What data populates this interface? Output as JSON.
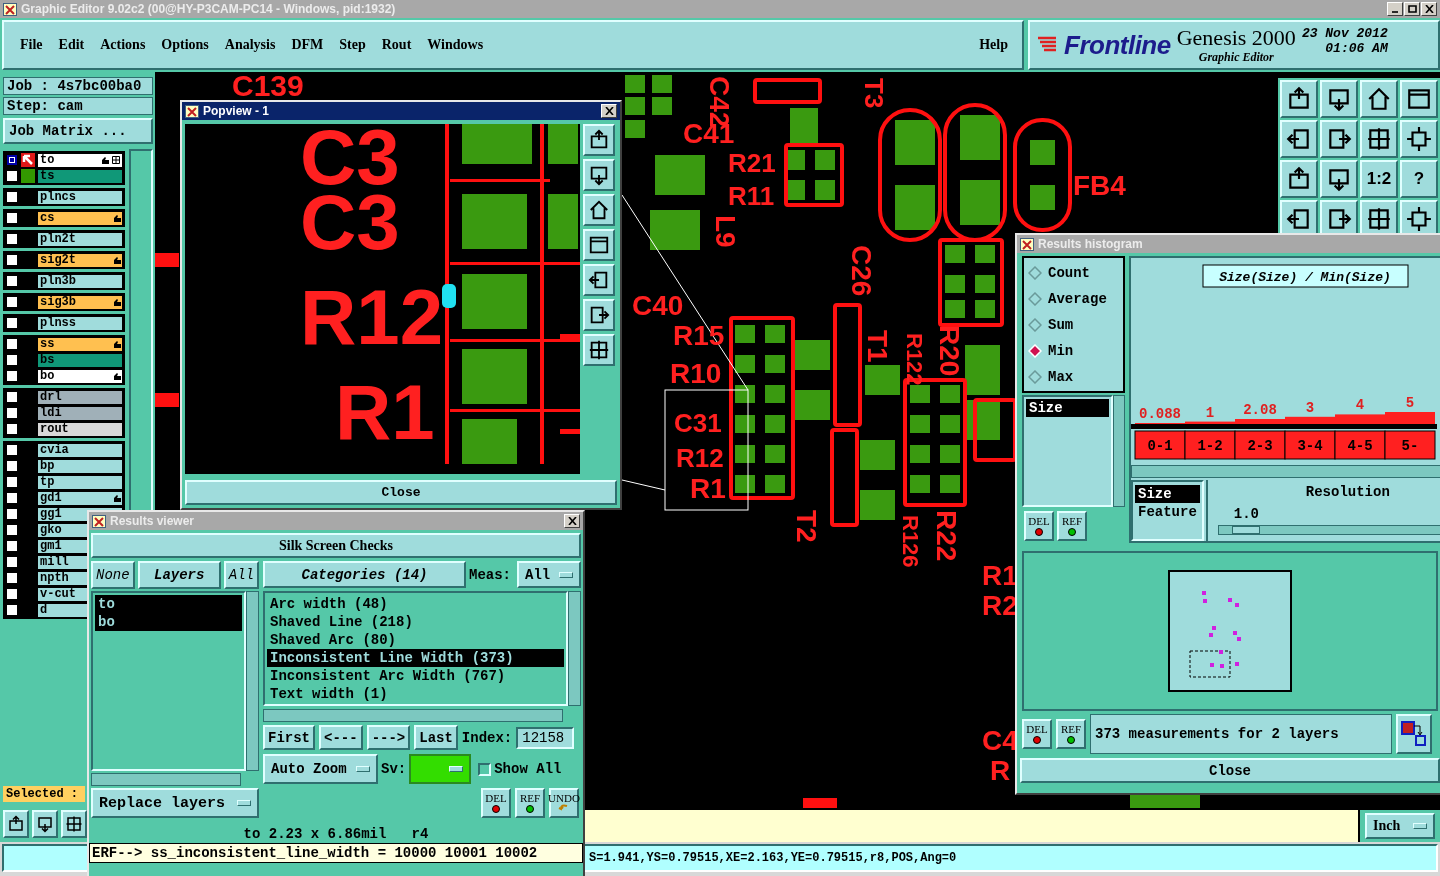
{
  "window": {
    "title": "Graphic Editor 9.02c2 (00@HY-P3CAM-PC14 - Windows, pid:1932)"
  },
  "menu": {
    "items": [
      "File",
      "Edit",
      "Actions",
      "Options",
      "Analysis",
      "DFM",
      "Step",
      "Rout",
      "Windows"
    ],
    "help": "Help"
  },
  "brand": {
    "logo": "Frontline",
    "product": "Genesis 2000",
    "subtitle": "Graphic Editor",
    "date": "23 Nov 2012",
    "time": "01:06 AM"
  },
  "job": {
    "job": "Job : 4s7bc00ba0",
    "step": "Step: cam",
    "matrix_button": "Job Matrix ..."
  },
  "layer_groups": [
    {
      "layers": [
        {
          "name": "to",
          "color": "#ffffff",
          "work": true,
          "displayed": false,
          "affected": true
        },
        {
          "name": "ts",
          "color": "#109878",
          "work": false,
          "displayed": true,
          "affected": false
        }
      ]
    },
    {
      "layers": [
        {
          "name": "plncs",
          "color": "#a0dcdc",
          "work": false,
          "displayed": false,
          "affected": false
        }
      ]
    },
    {
      "layers": [
        {
          "name": "cs",
          "color": "#ffc050",
          "work": false,
          "displayed": false,
          "affected": true
        }
      ]
    },
    {
      "layers": [
        {
          "name": "pln2t",
          "color": "#a0dcdc",
          "work": false,
          "displayed": false,
          "affected": false
        }
      ]
    },
    {
      "layers": [
        {
          "name": "sig2t",
          "color": "#ffc050",
          "work": false,
          "displayed": false,
          "affected": true
        }
      ]
    },
    {
      "layers": [
        {
          "name": "pln3b",
          "color": "#a0dcdc",
          "work": false,
          "displayed": false,
          "affected": false
        }
      ]
    },
    {
      "layers": [
        {
          "name": "sig3b",
          "color": "#ffc050",
          "work": false,
          "displayed": false,
          "affected": true
        }
      ]
    },
    {
      "layers": [
        {
          "name": "plnss",
          "color": "#a0dcdc",
          "work": false,
          "displayed": false,
          "affected": false
        }
      ]
    },
    {
      "layers": [
        {
          "name": "ss",
          "color": "#ffc050",
          "work": false,
          "displayed": false,
          "affected": true
        },
        {
          "name": "bs",
          "color": "#109878",
          "work": false,
          "displayed": false,
          "affected": false
        },
        {
          "name": "bo",
          "color": "#ffffff",
          "work": false,
          "displayed": false,
          "affected": true
        }
      ]
    },
    {
      "layers": [
        {
          "name": "drl",
          "color": "#a0b0b8",
          "work": false,
          "displayed": false,
          "affected": false
        },
        {
          "name": "ldi",
          "color": "#a0b0b8",
          "work": false,
          "displayed": false,
          "affected": false
        },
        {
          "name": "rout",
          "color": "#d8d8d8",
          "work": false,
          "displayed": false,
          "affected": false
        }
      ]
    },
    {
      "layers": [
        {
          "name": "cvia",
          "color": "#a0dcdc",
          "work": false,
          "displayed": false,
          "affected": false
        },
        {
          "name": "bp",
          "color": "#a0dcdc",
          "work": false,
          "displayed": false,
          "affected": false
        },
        {
          "name": "tp",
          "color": "#a0dcdc",
          "work": false,
          "displayed": false,
          "affected": false
        },
        {
          "name": "gd1",
          "color": "#a0dcdc",
          "work": false,
          "displayed": false,
          "affected": true
        },
        {
          "name": "gg1",
          "color": "#a0dcdc",
          "work": false,
          "displayed": false,
          "affected": false
        },
        {
          "name": "gko",
          "color": "#a0dcdc",
          "work": false,
          "displayed": false,
          "affected": false
        },
        {
          "name": "gm1",
          "color": "#a0dcdc",
          "work": false,
          "displayed": false,
          "affected": false
        },
        {
          "name": "mill",
          "color": "#a0dcdc",
          "work": false,
          "displayed": false,
          "affected": false
        },
        {
          "name": "npth",
          "color": "#a0dcdc",
          "work": false,
          "displayed": false,
          "affected": false
        },
        {
          "name": "v-cut",
          "color": "#a0dcdc",
          "work": false,
          "displayed": false,
          "affected": false
        },
        {
          "name": "d",
          "color": "#a0dcdc",
          "work": false,
          "displayed": false,
          "affected": false
        }
      ]
    }
  ],
  "selected_label": "Selected :",
  "canvas": {
    "labels": [
      "C139",
      "C42",
      "C41",
      "R21",
      "R11",
      "FB4",
      "L9",
      "C26",
      "C40",
      "R15",
      "R10",
      "C31",
      "R12",
      "R1",
      "T1",
      "R122",
      "R20",
      "T2",
      "R126",
      "R22",
      "R1",
      "R2",
      "C4",
      "R",
      "T3"
    ],
    "toolbar": [
      {
        "kind": "icon"
      },
      {
        "kind": "icon"
      },
      {
        "kind": "icon"
      },
      {
        "kind": "icon"
      },
      {
        "kind": "icon"
      },
      {
        "kind": "icon"
      },
      {
        "kind": "icon"
      },
      {
        "kind": "icon"
      },
      {
        "kind": "icon"
      },
      {
        "kind": "icon"
      },
      {
        "kind": "text",
        "label": "1:2"
      },
      {
        "kind": "text",
        "label": "?"
      },
      {
        "kind": "icon"
      },
      {
        "kind": "icon"
      },
      {
        "kind": "icon"
      },
      {
        "kind": "icon"
      }
    ]
  },
  "popview": {
    "title": "Popview - 1",
    "labels": [
      "C3",
      "C3",
      "R12",
      "R1"
    ],
    "close": "Close"
  },
  "results_viewer": {
    "title": "Results viewer",
    "header": "Silk Screen Checks",
    "layer_buttons": [
      "None",
      "Layers",
      "All"
    ],
    "layers": [
      {
        "name": "to",
        "selected": true
      },
      {
        "name": "bo",
        "selected": true
      }
    ],
    "categories_header": "Categories (14)",
    "meas_label": "Meas:",
    "meas_value": "All",
    "categories": [
      {
        "name": "Arc width (48)",
        "selected": false
      },
      {
        "name": "Shaved Line (218)",
        "selected": false
      },
      {
        "name": "Shaved Arc (80)",
        "selected": false
      },
      {
        "name": "Inconsistent Line Width (373)",
        "selected": true
      },
      {
        "name": "Inconsistent Arc Width (767)",
        "selected": false
      },
      {
        "name": "Text width (1)",
        "selected": false
      }
    ],
    "nav": [
      "First",
      "<---",
      "--->",
      "Last"
    ],
    "index_label": "Index:",
    "index_value": "12158",
    "zoom": "Auto Zoom",
    "sv_label": "Sv:",
    "show_all": {
      "label": "Show All",
      "checked": false
    },
    "replace": "Replace layers",
    "actions": [
      "DEL",
      "REF",
      "UNDO"
    ],
    "info": "to 2.23 x 6.86mil   r4",
    "erf": "ERF--> ss_inconsistent_line_width = 10000 10001 10002"
  },
  "histogram": {
    "title": "Results histogram",
    "modes": [
      {
        "label": "Count",
        "selected": false
      },
      {
        "label": "Average",
        "selected": false
      },
      {
        "label": "Sum",
        "selected": false
      },
      {
        "label": "Min",
        "selected": true
      },
      {
        "label": "Max",
        "selected": false
      }
    ],
    "fields": [
      {
        "label": "Size",
        "selected": true
      }
    ],
    "actions": [
      "DEL",
      "REF"
    ],
    "chart_data": {
      "type": "bar",
      "title": "Size(Size) / Min(Size)",
      "categories": [
        "0-1",
        "1-2",
        "2-3",
        "3-4",
        "4-5",
        "5-"
      ],
      "values": [
        0.088,
        1,
        2.08,
        3,
        4,
        5
      ],
      "data_labels": true
    },
    "attributes": [
      {
        "label": "Size",
        "selected": true
      },
      {
        "label": "Feature",
        "selected": false
      }
    ],
    "resolution_label": "Resolution",
    "resolution_value": "1.0",
    "resolution_slider": {
      "level": 0.05
    },
    "map_actions": [
      "DEL",
      "REF"
    ],
    "message": "373 measurements for 2 layers",
    "close": "Close"
  },
  "units": "Inch",
  "status": "S=1.941,YS=0.79515,XE=2.163,YE=0.79515,r8,POS,Ang=0"
}
